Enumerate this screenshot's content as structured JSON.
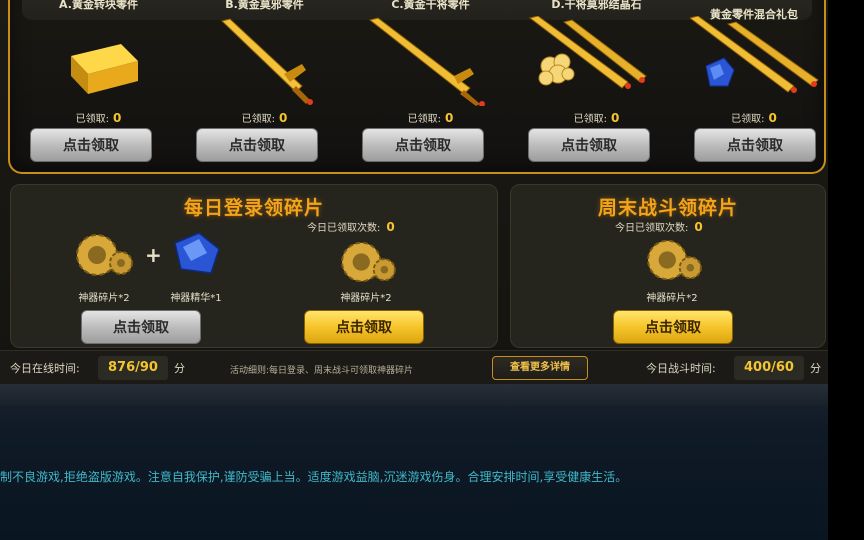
{
  "top_items": [
    {
      "title": "A.黄金转块零件",
      "claimed_label": "已领取:",
      "claimed": "0",
      "button": "点击领取",
      "icon": "gold-bar-icon"
    },
    {
      "title": "B.黄金莫邪零件",
      "claimed_label": "已领取:",
      "claimed": "0",
      "button": "点击领取",
      "icon": "golden-sword-icon"
    },
    {
      "title": "C.黄金干将零件",
      "claimed_label": "已领取:",
      "claimed": "0",
      "button": "点击领取",
      "icon": "golden-blade-icon"
    },
    {
      "title": "D.干将莫邪结晶石",
      "claimed_label": "已领取:",
      "claimed": "0",
      "button": "点击领取",
      "icon": "crystal-swords-icon"
    },
    {
      "title": "黄金零件混合礼包",
      "claimed_label": "已领取:",
      "claimed": "0",
      "button": "点击领取",
      "icon": "mixed-gift-icon"
    }
  ],
  "daily_login": {
    "title": "每日登录领碎片",
    "items": [
      {
        "label": "神器碎片*2",
        "icon": "gear-fragment-icon"
      },
      {
        "label": "神器精华*1",
        "icon": "blue-gem-icon"
      }
    ],
    "button_left": "点击领取",
    "count_label": "今日已领取次数:",
    "count": "0",
    "reward_label": "神器碎片*2",
    "button_right": "点击领取"
  },
  "weekend_battle": {
    "title": "周末战斗领碎片",
    "count_label": "今日已领取次数:",
    "count": "0",
    "reward_label": "神器碎片*2",
    "button": "点击领取"
  },
  "info": {
    "online_label": "今日在线时间:",
    "online_value": "876/90",
    "online_unit": "分",
    "rules": "活动细则:每日登录、周末战斗可领取神器碎片",
    "more_button": "查看更多详情",
    "battle_label": "今日战斗时间:",
    "battle_value": "400/60",
    "battle_unit": "分"
  },
  "notice": "制不良游戏,拒绝盗版游戏。注意自我保护,谨防受骗上当。适度游戏益脑,沉迷游戏伤身。合理安排时间,享受健康生活。",
  "colors": {
    "accent_gold": "#f5c531",
    "title_orange": "#f2a51c",
    "border_gold": "#c98e18",
    "notice_cyan": "#3fb9c9"
  }
}
